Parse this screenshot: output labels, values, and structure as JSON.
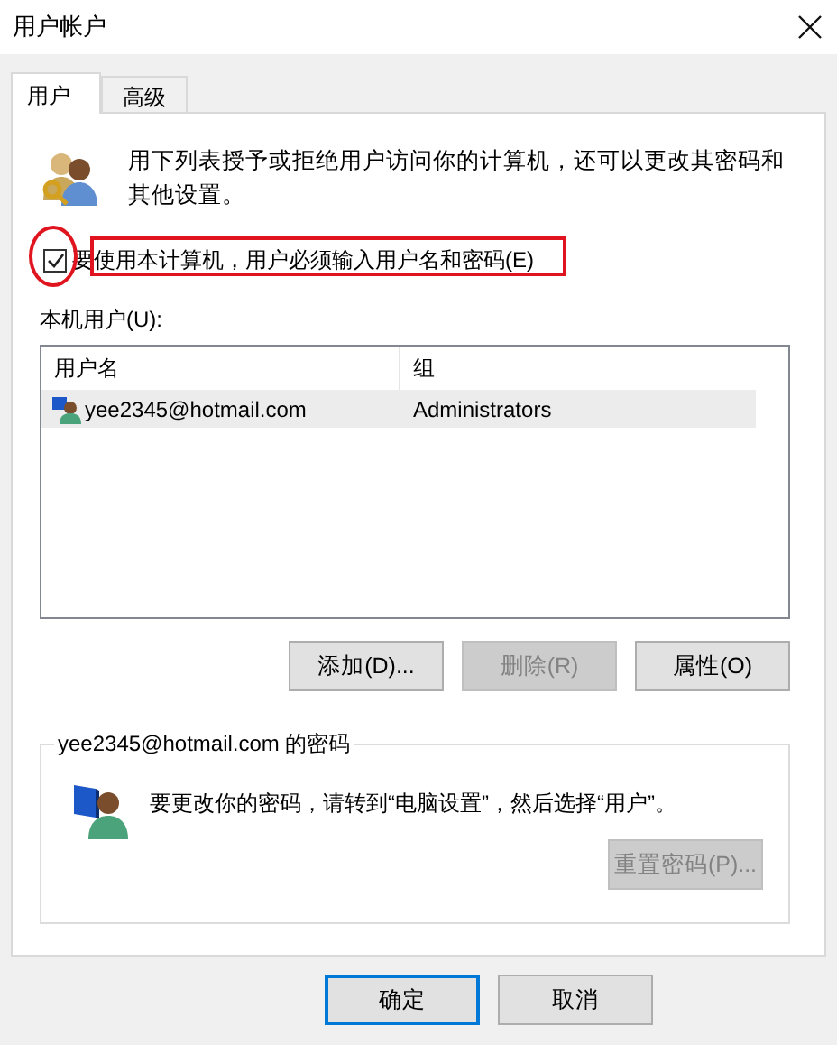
{
  "window": {
    "title": "用户帐户"
  },
  "tabs": [
    {
      "label": "用户",
      "selected": true
    },
    {
      "label": "高级",
      "selected": false
    }
  ],
  "intro": "用下列表授予或拒绝用户访问你的计算机，还可以更改其密码和其他设置。",
  "require_password": {
    "label": "要使用本计算机，用户必须输入用户名和密码(E)",
    "checked": true
  },
  "users_label": "本机用户(U):",
  "table": {
    "columns": [
      "用户名",
      "组"
    ],
    "rows": [
      {
        "cells": [
          "yee2345@hotmail.com",
          "Administrators"
        ],
        "selected": true
      }
    ]
  },
  "user_buttons": [
    {
      "label": "添加(D)...",
      "disabled": false
    },
    {
      "label": "删除(R)",
      "disabled": true
    },
    {
      "label": "属性(O)",
      "disabled": false
    }
  ],
  "password_group": {
    "title": "yee2345@hotmail.com 的密码",
    "text": "要更改你的密码，请转到“电脑设置”，然后选择“用户”。",
    "button": {
      "label": "重置密码(P)...",
      "disabled": true
    }
  },
  "footer_buttons": [
    {
      "label": "确定",
      "default": true
    },
    {
      "label": "取消",
      "default": false
    }
  ],
  "highlights": [
    {
      "kind": "ellipse"
    },
    {
      "kind": "rectangle"
    }
  ]
}
